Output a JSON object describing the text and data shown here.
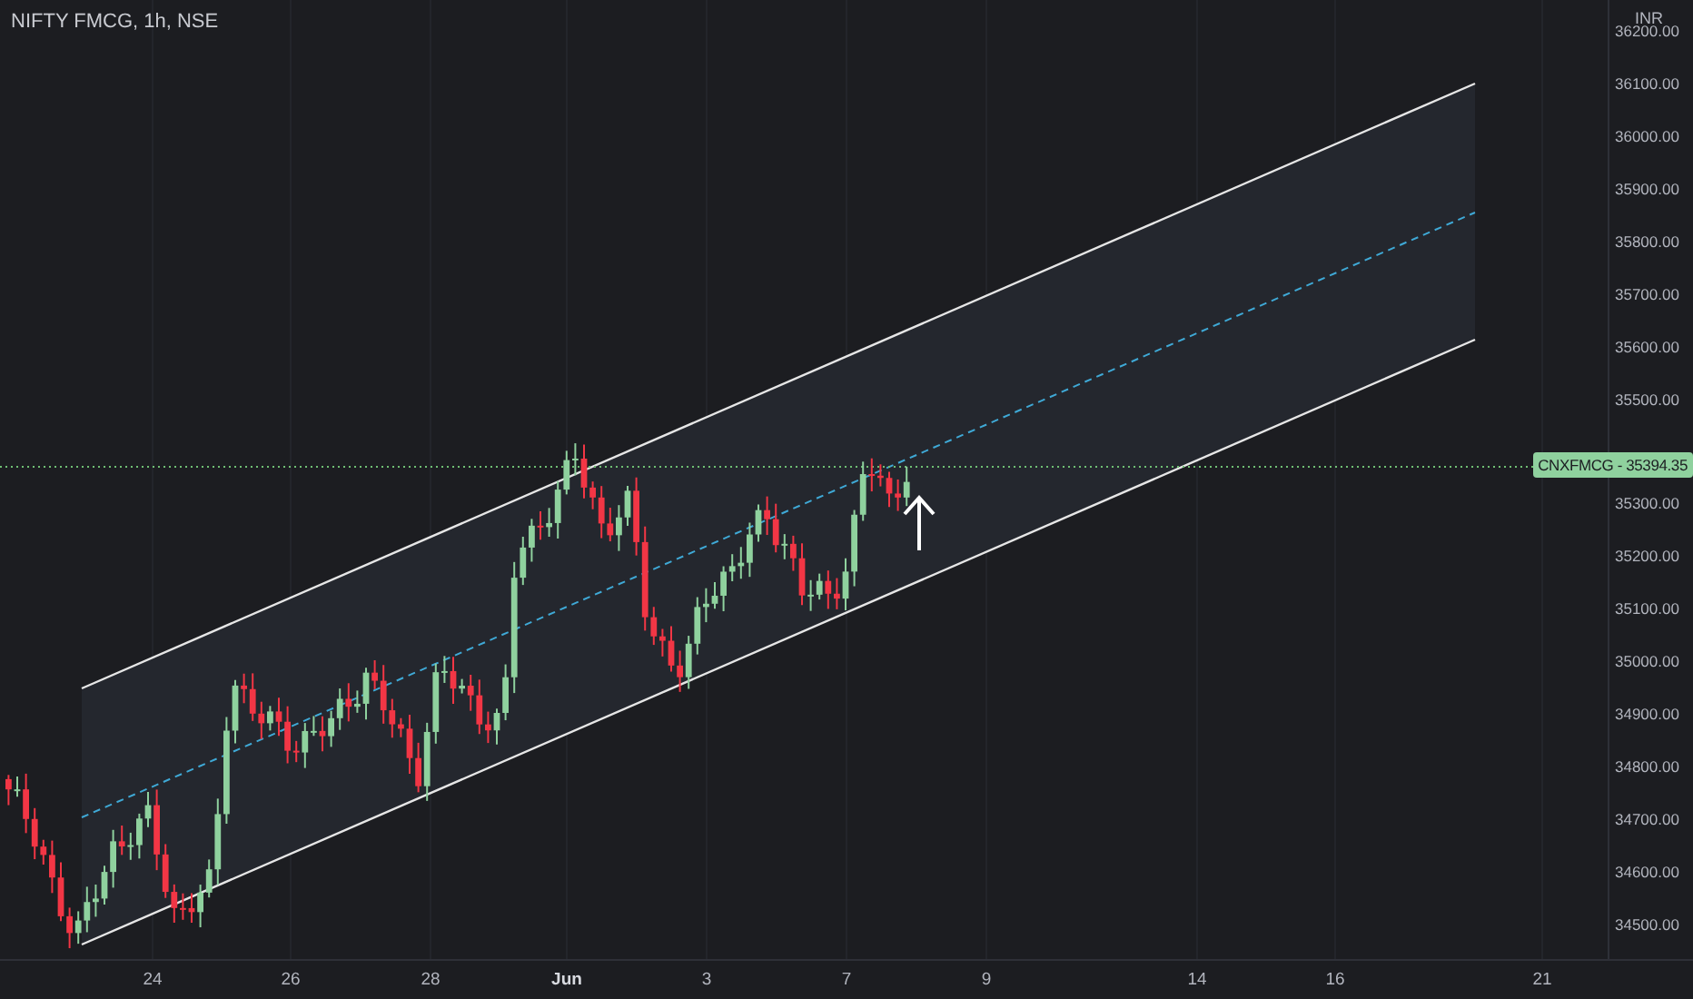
{
  "chart": {
    "title": "NIFTY FMCG, 1h, NSE",
    "currency": "INR",
    "price_ticks": [
      "36200.00",
      "36100.00",
      "36000.00",
      "35900.00",
      "35800.00",
      "35700.00",
      "35600.00",
      "35500.00",
      "35300.00",
      "35200.00",
      "35100.00",
      "35000.00",
      "34900.00",
      "34800.00",
      "34700.00",
      "34600.00",
      "34500.00"
    ],
    "price_tag": "CNXFMCG - 35394.35",
    "time_ticks": [
      {
        "label": "24",
        "bold": false
      },
      {
        "label": "26",
        "bold": false
      },
      {
        "label": "28",
        "bold": false
      },
      {
        "label": "Jun",
        "bold": true
      },
      {
        "label": "3",
        "bold": false
      },
      {
        "label": "7",
        "bold": false
      },
      {
        "label": "9",
        "bold": false
      },
      {
        "label": "14",
        "bold": false
      },
      {
        "label": "16",
        "bold": false
      },
      {
        "label": "21",
        "bold": false
      }
    ]
  }
}
